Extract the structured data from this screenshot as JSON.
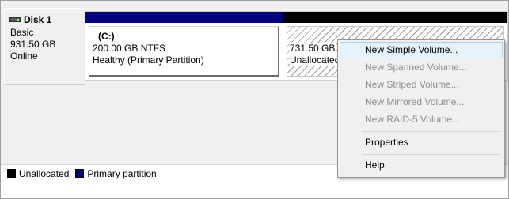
{
  "disk": {
    "name": "Disk 1",
    "type": "Basic",
    "size": "931.50 GB",
    "status": "Online"
  },
  "partitions": [
    {
      "title": "(C:)",
      "size_fs": "200.00 GB NTFS",
      "status": "Healthy (Primary Partition)",
      "bar_color": "#000080"
    },
    {
      "size": "731.50 GB",
      "status": "Unallocated",
      "bar_color": "#000000"
    }
  ],
  "legend": [
    {
      "label": "Unallocated",
      "color": "#000000"
    },
    {
      "label": "Primary partition",
      "color": "#000080"
    }
  ],
  "context_menu": {
    "items": [
      {
        "label": "New Simple Volume...",
        "enabled": true,
        "highlighted": true
      },
      {
        "label": "New Spanned Volume...",
        "enabled": false
      },
      {
        "label": "New Striped Volume...",
        "enabled": false
      },
      {
        "label": "New Mirrored Volume...",
        "enabled": false
      },
      {
        "label": "New RAID-5 Volume...",
        "enabled": false
      },
      {
        "label": "Properties",
        "enabled": true
      },
      {
        "label": "Help",
        "enabled": true
      }
    ]
  }
}
